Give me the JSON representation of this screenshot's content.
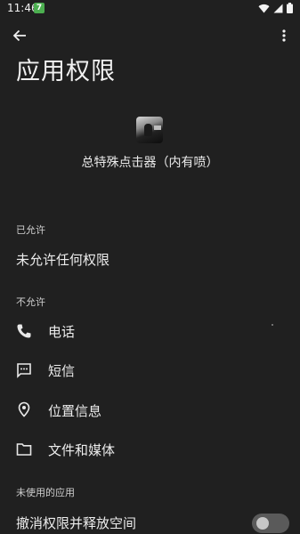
{
  "status": {
    "time": "11:46",
    "notif_glyph": "7"
  },
  "header": {
    "title": "应用权限"
  },
  "app": {
    "name": "总特殊点击器（内有喷）"
  },
  "allowed": {
    "label": "已允许",
    "empty_text": "未允许任何权限"
  },
  "denied": {
    "label": "不允许",
    "items": [
      {
        "icon": "phone-icon",
        "label": "电话"
      },
      {
        "icon": "message-icon",
        "label": "短信"
      },
      {
        "icon": "location-icon",
        "label": "位置信息"
      },
      {
        "icon": "folder-icon",
        "label": "文件和媒体"
      }
    ]
  },
  "unused": {
    "label": "未使用的应用",
    "revoke_label": "撤消权限并释放空间",
    "toggle_on": false
  },
  "colors": {
    "background": "#202020",
    "text": "#ececec",
    "toggle_off": "#5a5a5a"
  }
}
